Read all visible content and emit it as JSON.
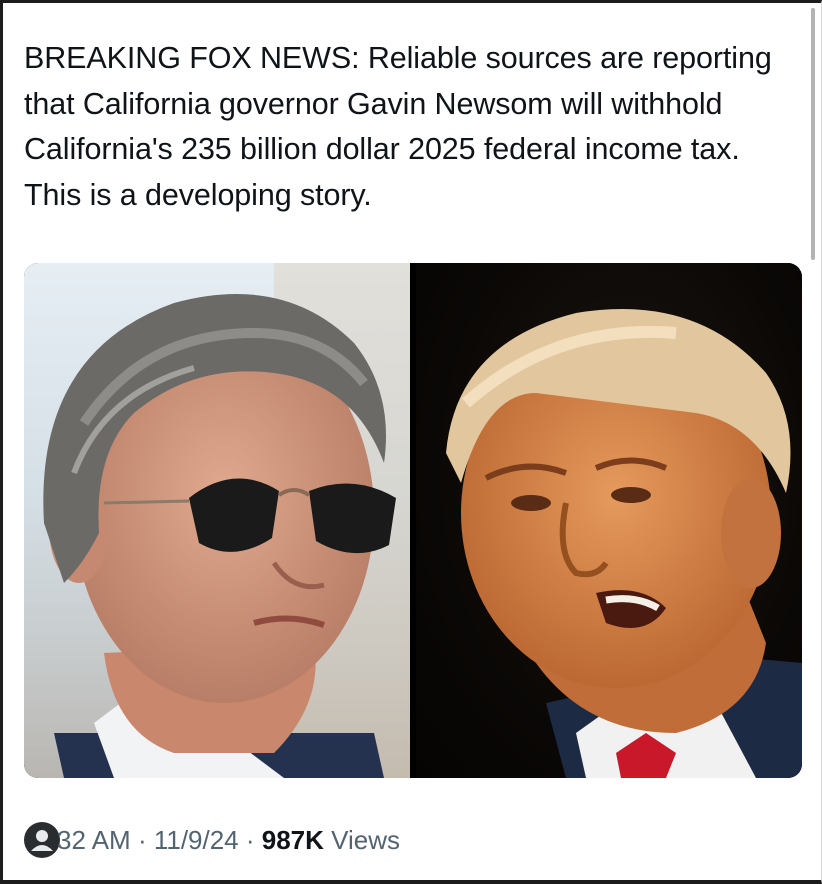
{
  "post": {
    "text": "BREAKING FOX NEWS: Reliable sources are reporting that California governor Gavin Newsom will withhold California's 235 billion dollar 2025 federal income tax. This is a developing story.",
    "time": "32 AM",
    "separator": " · ",
    "date": "11/9/24",
    "views_count": "987K",
    "views_label": " Views"
  },
  "colors": {
    "text_primary": "#0f1419",
    "text_secondary": "#536471",
    "frame": "#1c1c1c"
  },
  "icons": {
    "overlay_avatar": "person-icon"
  }
}
